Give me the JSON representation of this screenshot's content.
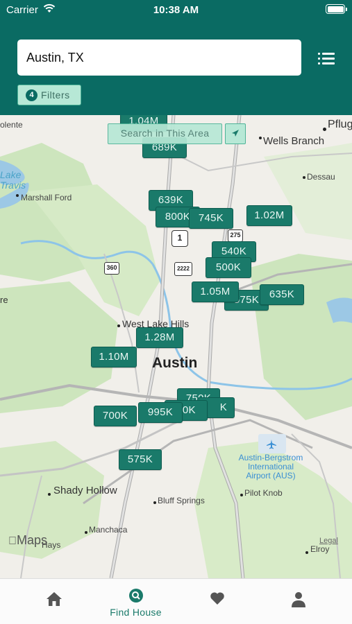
{
  "status_bar": {
    "carrier": "Carrier",
    "time": "10:38 AM"
  },
  "search": {
    "value": "Austin, TX"
  },
  "filters": {
    "count": "4",
    "label": "Filters"
  },
  "map": {
    "search_area_label": "Search in This Area",
    "places": {
      "pflug": "Pflug",
      "wells_branch": "Wells Branch",
      "dessau": "Dessau",
      "marshall_ford": "Marshall Ford",
      "lake_travis_1": "Lake",
      "lake_travis_2": "Travis",
      "olente": "olente",
      "re": "re",
      "west_lake_hills": "West Lake Hills",
      "austin": "Austin",
      "airport_1": "Austin-Bergstrom",
      "airport_2": "International",
      "airport_3": "Airport (AUS)",
      "shady_hollow": "Shady Hollow",
      "bluff_springs": "Bluff Springs",
      "pilot_knob": "Pilot Knob",
      "manchaca": "Manchaca",
      "hays": "Hays",
      "elroy": "Elroy"
    },
    "shields": {
      "s1": "1",
      "s275": "275",
      "s360": "360",
      "s2222": "2222"
    },
    "maps_logo": "Maps",
    "legal": "Legal",
    "pins": [
      "1.04M",
      "689K",
      "639K",
      "800K",
      "745K",
      "1.02M",
      "540K",
      "500K",
      "1.05M",
      "575K",
      "635K",
      "1.28M",
      "1.10M",
      "750K",
      "50K",
      "K",
      "700K",
      "995K",
      "575K"
    ]
  },
  "tabs": [
    {
      "icon": "home-icon",
      "label": ""
    },
    {
      "icon": "search-icon",
      "label": "Find House"
    },
    {
      "icon": "heart-icon",
      "label": ""
    },
    {
      "icon": "person-icon",
      "label": ""
    }
  ],
  "colors": {
    "brand": "#0a6b63",
    "pin": "#1a7a6a",
    "chip": "#b7e8d6"
  }
}
